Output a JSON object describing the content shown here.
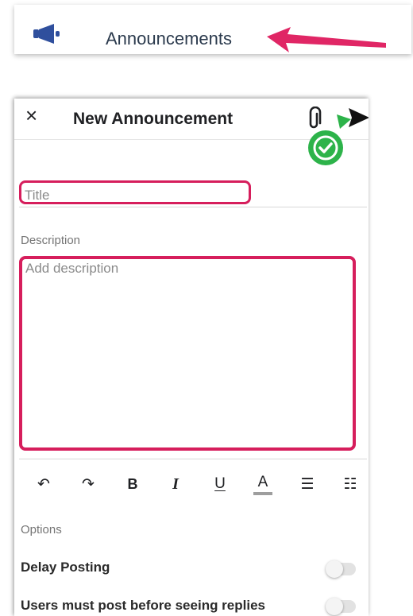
{
  "top_bar": {
    "icon": "megaphone-icon",
    "label": "Announcements"
  },
  "header": {
    "close_icon": "close-icon",
    "close_glyph": "×",
    "title": "New Announcement",
    "attach_icon": "paperclip-icon",
    "send_icon": "send-icon"
  },
  "form": {
    "title_placeholder": "Title",
    "description_label": "Description",
    "description_placeholder": "Add description"
  },
  "toolbar": {
    "items": [
      {
        "name": "undo-icon",
        "glyph": "↶"
      },
      {
        "name": "redo-icon",
        "glyph": "↷"
      },
      {
        "name": "bold-button",
        "glyph": "B"
      },
      {
        "name": "italic-button",
        "glyph": "I"
      },
      {
        "name": "underline-button",
        "glyph": "U"
      },
      {
        "name": "text-color-button",
        "glyph": "A"
      },
      {
        "name": "bullet-list-icon",
        "glyph": "☰"
      },
      {
        "name": "numbered-list-icon",
        "glyph": "☷"
      }
    ]
  },
  "options": {
    "label": "Options",
    "delay_posting": {
      "label": "Delay Posting",
      "enabled": false
    },
    "post_before_replies": {
      "label": "Users must post before seeing replies",
      "enabled": false
    }
  },
  "colors": {
    "highlight_red": "#d61e5c",
    "megaphone": "#2f4f9d",
    "check_green": "#2db34a"
  }
}
